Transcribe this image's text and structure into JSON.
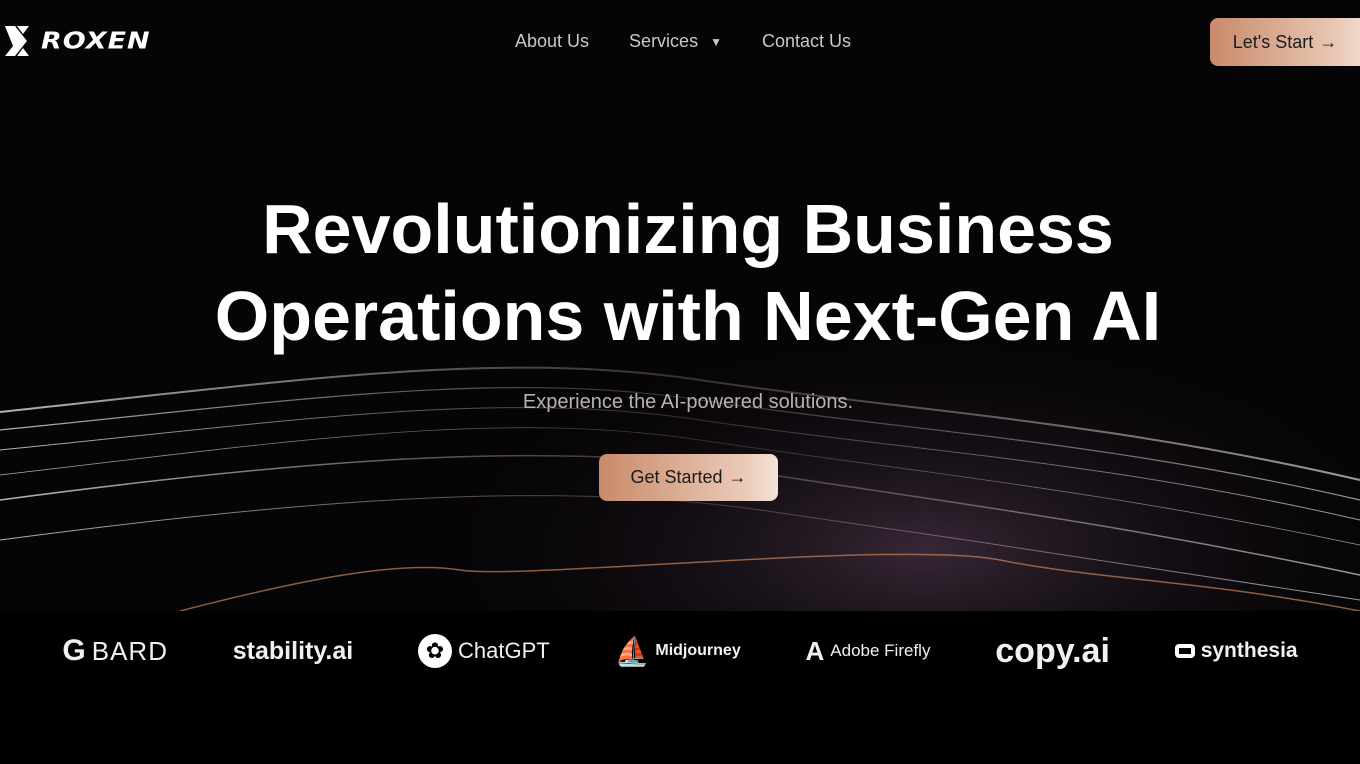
{
  "nav": {
    "logo": "ROXEN",
    "items": [
      {
        "label": "About Us"
      },
      {
        "label": "Services",
        "icon": "caret-down-icon"
      },
      {
        "label": "Contact Us"
      }
    ],
    "cta": "Let's Start",
    "cta_icon": "arrow-right-icon"
  },
  "hero": {
    "title_line1": "Revolutionizing Business",
    "title_line2": "Operations with Next-Gen AI",
    "subtitle": "Experience the AI-powered solutions.",
    "button": "Get Started"
  },
  "partners": [
    "BARD",
    "stability.ai",
    "ChatGPT",
    "Midjourney",
    "Adobe Firefly",
    "copy.ai",
    "synthesia"
  ],
  "colors": {
    "accent_start": "#c98a6a",
    "accent_end": "#f3e2d8",
    "background": "#000000"
  }
}
